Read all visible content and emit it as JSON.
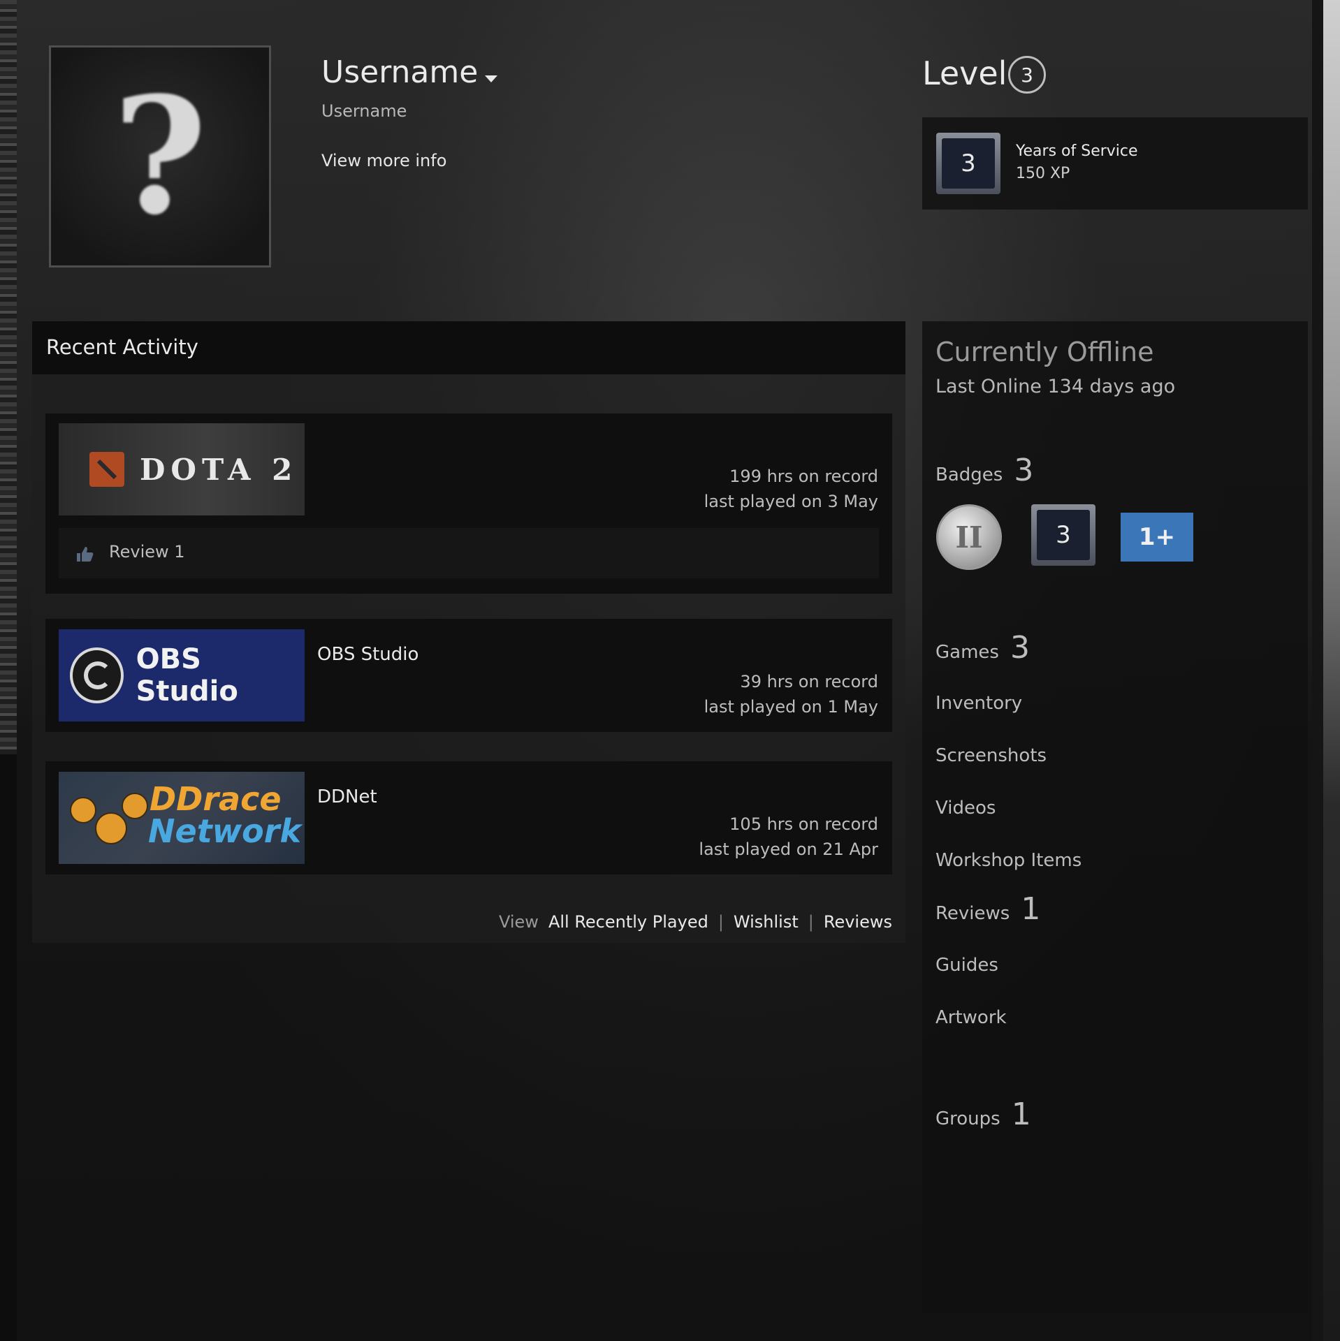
{
  "profile": {
    "persona_name": "Username",
    "real_name": "Username",
    "more_info": "View more info",
    "avatar_glyph": "?"
  },
  "level": {
    "label": "Level",
    "value": "3",
    "favorite_badge": {
      "icon_text": "3",
      "name": "Years of Service",
      "xp": "150 XP"
    }
  },
  "activity": {
    "title": "Recent Activity",
    "games": [
      {
        "name": "",
        "capsule_text": "DOTA 2",
        "hours": "199 hrs on record",
        "last_played": "last played on 3 May",
        "review_label": "Review 1"
      },
      {
        "name": "OBS Studio",
        "capsule_text": "OBS Studio",
        "hours": "39 hrs on record",
        "last_played": "last played on 1 May"
      },
      {
        "name": "DDNet",
        "capsule_text_1": "DDrace",
        "capsule_text_2": "Network",
        "hours": "105 hrs on record",
        "last_played": "last played on 21 Apr"
      }
    ],
    "view_label": "View",
    "links": {
      "all_recently_played": "All Recently Played",
      "wishlist": "Wishlist",
      "reviews": "Reviews"
    },
    "separator": "|"
  },
  "status": {
    "title": "Currently Offline",
    "last_online": "Last Online 134 days ago"
  },
  "sections": {
    "badges": {
      "label": "Badges",
      "count": "3"
    },
    "badge_items": [
      {
        "icon": "coin-badge-icon",
        "text": "II"
      },
      {
        "icon": "years-of-service-badge-icon",
        "text": "3"
      },
      {
        "icon": "reviewer-badge-icon",
        "text": "1+"
      }
    ],
    "games": {
      "label": "Games",
      "count": "3"
    },
    "inventory": "Inventory",
    "screenshots": "Screenshots",
    "videos": "Videos",
    "workshop": "Workshop Items",
    "reviews": {
      "label": "Reviews",
      "count": "1"
    },
    "guides": "Guides",
    "artwork": "Artwork",
    "groups": {
      "label": "Groups",
      "count": "1"
    }
  },
  "colors": {
    "page_bg": "#111213",
    "panel_bg": "#0d0d0d",
    "text_primary": "#eaeaea",
    "text_secondary": "#bdbdbd",
    "reviewer_badge": "#3a76b8",
    "dota_logo": "#b04a22",
    "obs_capsule": "#1c2a6b"
  }
}
